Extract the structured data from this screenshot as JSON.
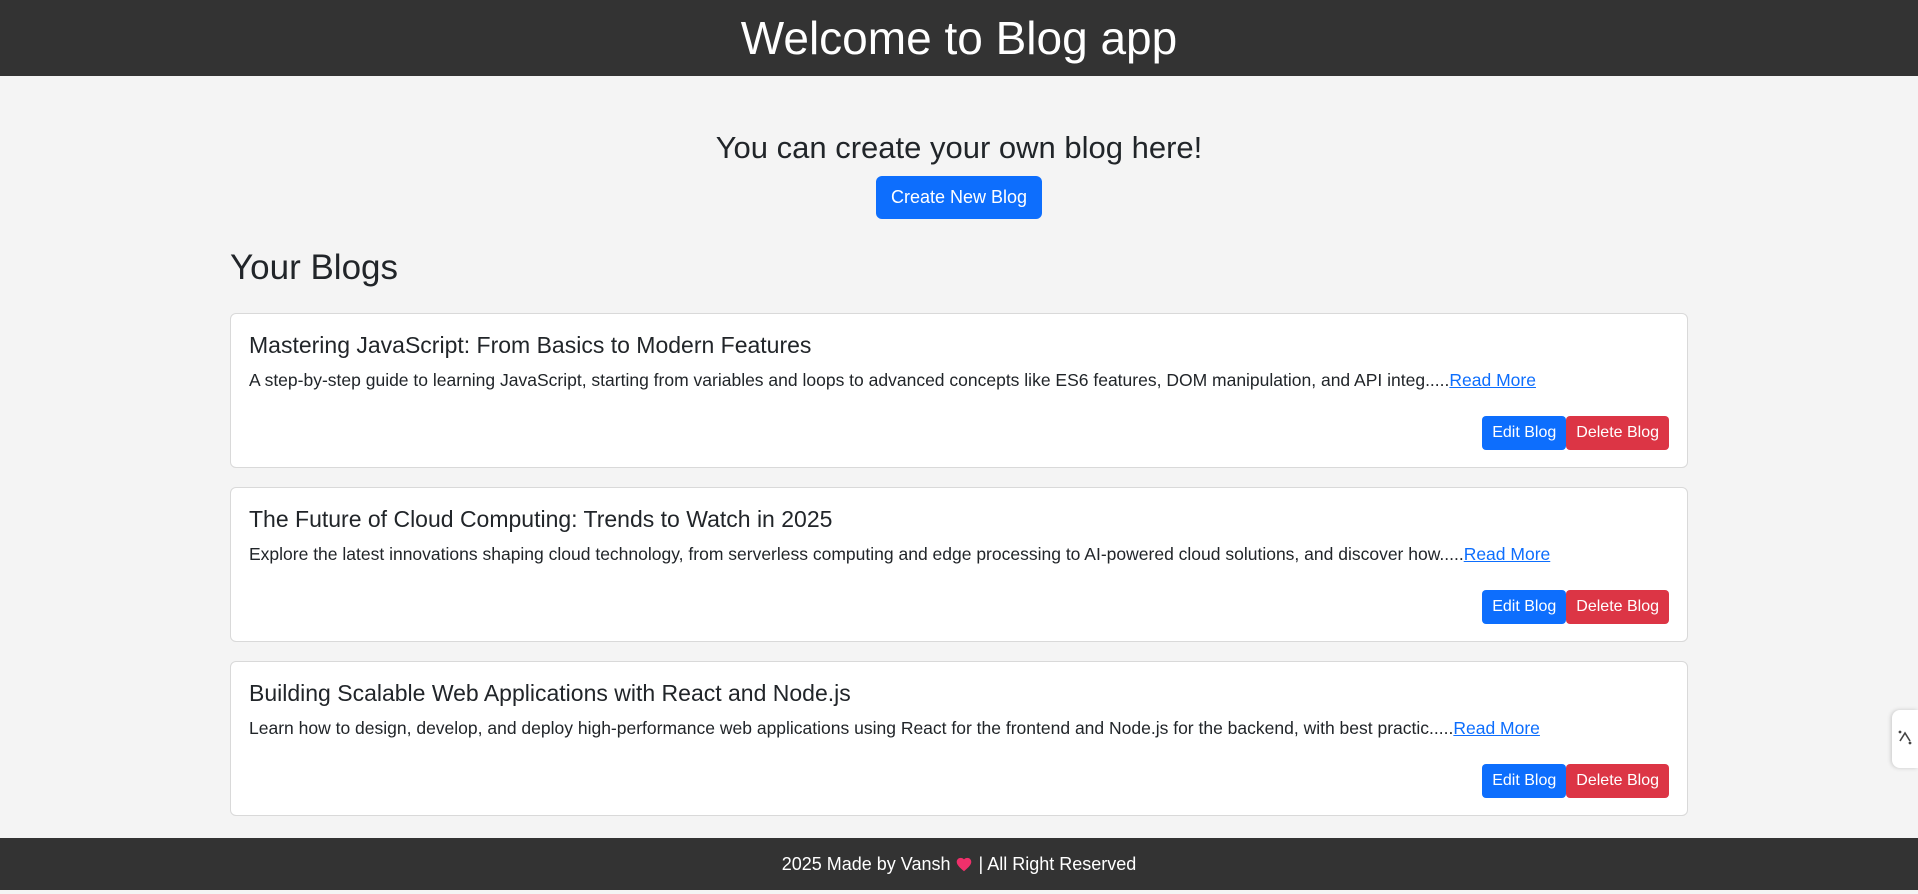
{
  "header": {
    "title": "Welcome to Blog app"
  },
  "hero": {
    "tagline": "You can create your own blog here!",
    "create_button": "Create New Blog"
  },
  "blogs": {
    "heading": "Your Blogs",
    "items": [
      {
        "title": "Mastering JavaScript: From Basics to Modern Features",
        "excerpt": "A step-by-step guide to learning JavaScript, starting from variables and loops to advanced concepts like ES6 features, DOM manipulation, and API integ.....",
        "read_more": "Read More",
        "edit": "Edit Blog",
        "delete": "Delete Blog"
      },
      {
        "title": "The Future of Cloud Computing: Trends to Watch in 2025",
        "excerpt": "Explore the latest innovations shaping cloud technology, from serverless computing and edge processing to AI-powered cloud solutions, and discover how.....",
        "read_more": "Read More",
        "edit": "Edit Blog",
        "delete": "Delete Blog"
      },
      {
        "title": "Building Scalable Web Applications with React and Node.js",
        "excerpt": "Learn how to design, develop, and deploy high-performance web applications using React for the frontend and Node.js for the backend, with best practic.....",
        "read_more": "Read More",
        "edit": "Edit Blog",
        "delete": "Delete Blog"
      }
    ]
  },
  "footer": {
    "text_before": "2025 Made by Vansh",
    "heart_icon": "heart-icon",
    "text_after": "| All Right Reserved"
  },
  "side_widget": {
    "icon": "extension-handle-icon"
  },
  "colors": {
    "header_bg": "#333333",
    "page_bg": "#f4f4f4",
    "primary": "#0d6efd",
    "danger": "#dc3545",
    "heart": "#f0306b"
  }
}
